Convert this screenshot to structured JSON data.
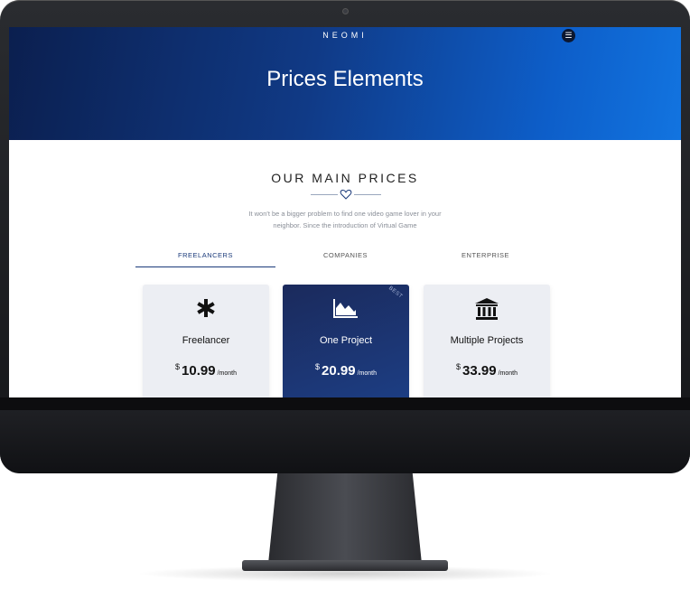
{
  "header": {
    "brand": "NEOMI",
    "menu_icon": "hamburger-icon",
    "title": "Prices Elements"
  },
  "section": {
    "title": "OUR MAIN PRICES",
    "subtitle": "It won't be a bigger problem to find one video game lover in your neighbor. Since the introduction of Virtual Game"
  },
  "tabs": [
    {
      "label": "FREELANCERS",
      "active": true
    },
    {
      "label": "COMPANIES",
      "active": false
    },
    {
      "label": "ENTERPRISE",
      "active": false
    }
  ],
  "plans": [
    {
      "name": "Freelancer",
      "currency": "$",
      "price": "10.99",
      "period": "/month",
      "icon": "asterisk-icon"
    },
    {
      "name": "One Project",
      "currency": "$",
      "price": "20.99",
      "period": "/month",
      "icon": "area-chart-icon",
      "badge": "BEST"
    },
    {
      "name": "Multiple Projects",
      "currency": "$",
      "price": "33.99",
      "period": "/month",
      "icon": "bank-icon"
    }
  ],
  "colors": {
    "hero_start": "#0b1f4f",
    "hero_end": "#1274e0",
    "featured_card": "#1c3f86",
    "tab_active": "#1a3a7a"
  }
}
